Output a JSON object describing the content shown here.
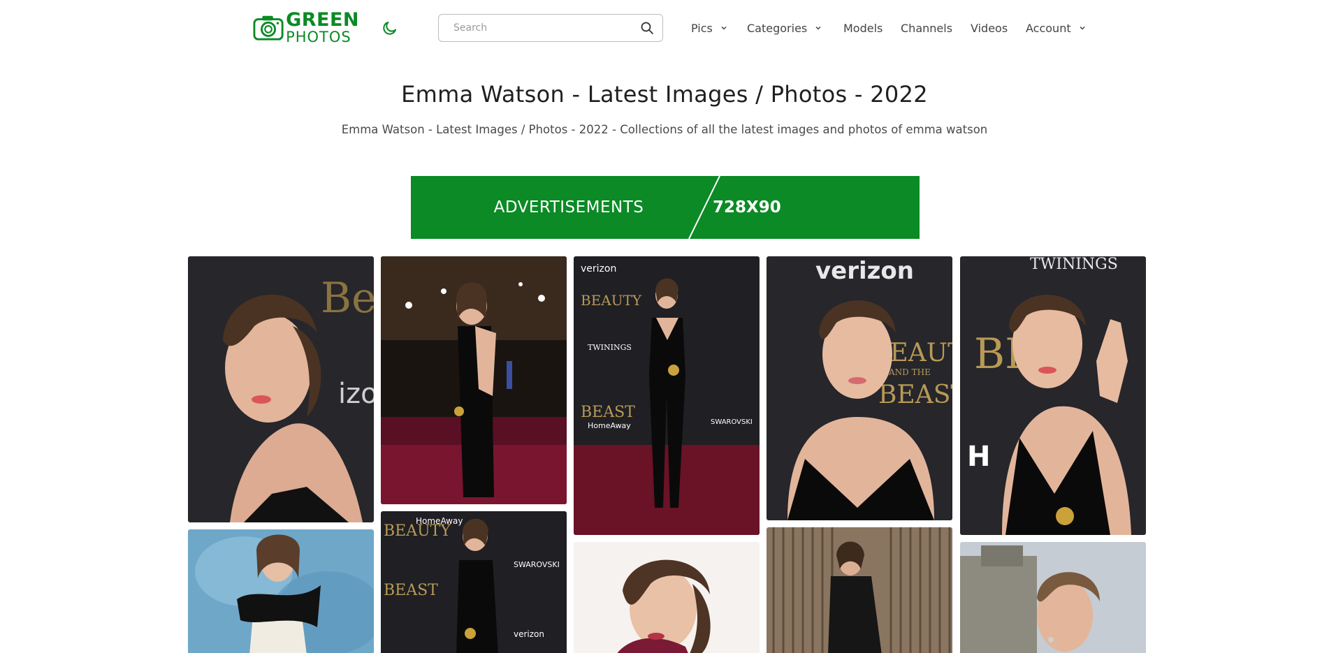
{
  "header": {
    "logo": {
      "line1": "GREEN",
      "line2": "PHOTOS"
    },
    "theme_toggle_icon": "moon-icon",
    "search": {
      "placeholder": "Search",
      "value": "",
      "icon": "search-icon"
    },
    "nav": [
      {
        "label": "Pics",
        "dropdown": true
      },
      {
        "label": "Categories",
        "dropdown": true
      },
      {
        "label": "Models",
        "dropdown": false
      },
      {
        "label": "Channels",
        "dropdown": false
      },
      {
        "label": "Videos",
        "dropdown": false
      },
      {
        "label": "Account",
        "dropdown": true
      }
    ]
  },
  "page": {
    "title": "Emma Watson - Latest Images / Photos - 2022",
    "subtitle": "Emma Watson - Latest Images / Photos - 2022 - Collections of all the latest images and photos of emma watson"
  },
  "ad": {
    "left_text": "ADVERTISEMENTS",
    "right_text": "728X90"
  },
  "gallery": {
    "photos": [
      {
        "text": [
          "Be",
          "izo"
        ]
      },
      {
        "text": []
      },
      {
        "text": [
          "verizon",
          "BEAUTY",
          "BEAST",
          "TWININGS",
          "HomeAway",
          "SWAROVSKI"
        ]
      },
      {
        "text": [
          "verizon",
          "BEAUTY",
          "AND THE",
          "BEAST"
        ]
      },
      {
        "text": [
          "TWININGS",
          "BE",
          "H"
        ]
      },
      {
        "text": []
      },
      {
        "text": [
          "HomeAway",
          "BEAUTY",
          "BEAST",
          "SWAROVSKI",
          "verizon"
        ]
      },
      {
        "text": []
      },
      {
        "text": []
      },
      {
        "text": []
      }
    ]
  },
  "colors": {
    "brand_green": "#0b8a25",
    "text_dark": "#1f1f1f",
    "text_muted": "#4a4a4a",
    "nav_text": "#444444"
  }
}
